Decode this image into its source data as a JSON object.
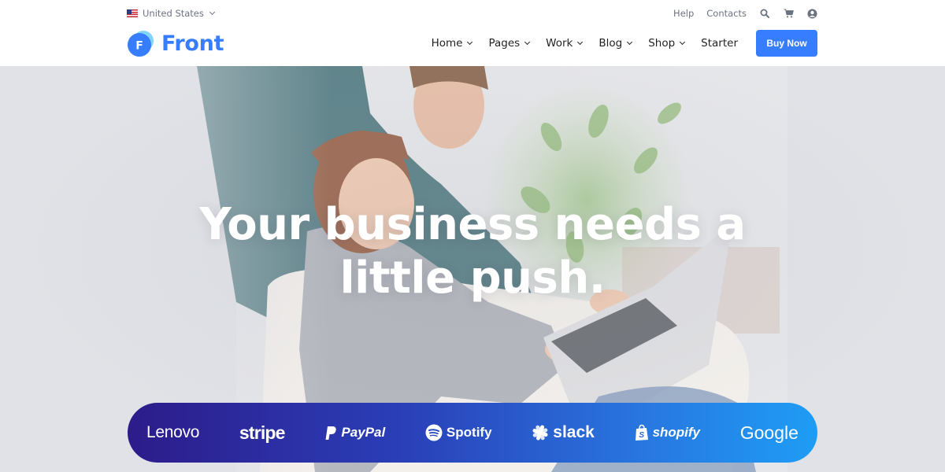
{
  "colors": {
    "accent": "#377dff",
    "text_dark": "#1e2022",
    "text_muted": "#6b7281",
    "strip_start": "#2d1b8a",
    "strip_end": "#1e9df5"
  },
  "topbar": {
    "locale": "United States",
    "links": [
      "Help",
      "Contacts"
    ],
    "icons": [
      "search-icon",
      "cart-icon",
      "user-icon"
    ]
  },
  "brand": {
    "logo_letter": "F",
    "name": "Front"
  },
  "nav": {
    "items": [
      {
        "label": "Home",
        "dropdown": true
      },
      {
        "label": "Pages",
        "dropdown": true
      },
      {
        "label": "Work",
        "dropdown": true
      },
      {
        "label": "Blog",
        "dropdown": true
      },
      {
        "label": "Shop",
        "dropdown": true
      },
      {
        "label": "Starter",
        "dropdown": false
      }
    ],
    "cta_label": "Buy Now"
  },
  "hero": {
    "headline_line1": "Your business needs a",
    "headline_line2": "little push."
  },
  "partners": [
    {
      "name": "Lenovo",
      "label": "Lenovo"
    },
    {
      "name": "stripe",
      "label": "stripe"
    },
    {
      "name": "PayPal",
      "label": "PayPal"
    },
    {
      "name": "Spotify",
      "label": "Spotify"
    },
    {
      "name": "slack",
      "label": "slack"
    },
    {
      "name": "shopify",
      "label": "shopify"
    },
    {
      "name": "Google",
      "label": "Google"
    }
  ]
}
